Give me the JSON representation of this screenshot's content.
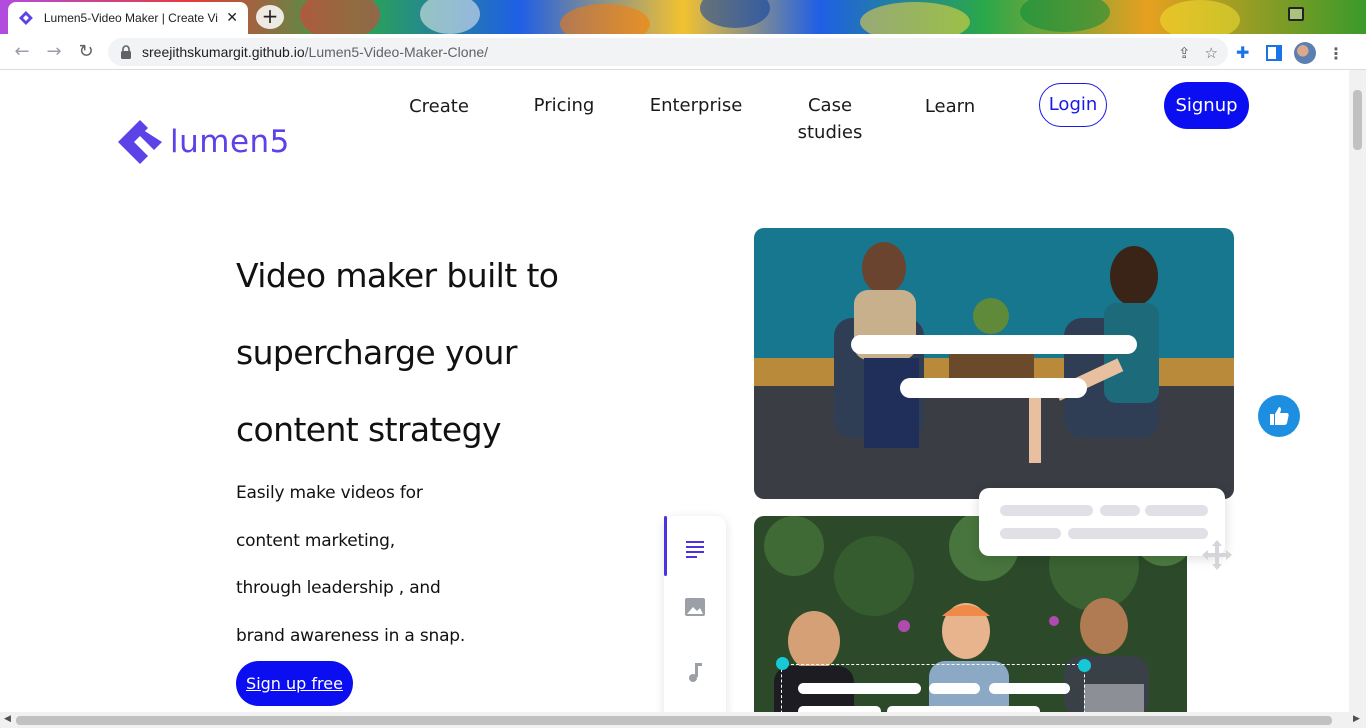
{
  "browser": {
    "tab_title": "Lumen5-Video Maker | Create Vi",
    "tab_close": "✕",
    "new_tab": "+",
    "url_host": "sreejithskumargit.github.io",
    "url_path": "/Lumen5-Video-Maker-Clone/"
  },
  "header": {
    "logo_text": "lumen5",
    "nav": [
      "Create",
      "Pricing",
      "Enterprise",
      "Case studies",
      "Learn"
    ],
    "login_label": "Login",
    "signup_label": "Signup"
  },
  "hero": {
    "headline_lines": [
      "Video maker built to",
      "supercharge your",
      "content strategy"
    ],
    "sub_lines": [
      "Easily make videos for",
      "content marketing,",
      "through leadership , and",
      "brand awareness in a snap."
    ],
    "cta_label": "Sign up free"
  },
  "colors": {
    "brand_purple": "#5c43e8",
    "cta_blue": "#0b0ef0",
    "thumbs_blue": "#1e8fe0",
    "handle_cyan": "#17c8d6"
  },
  "icons": {
    "editor_tools": [
      "text-lines-icon",
      "image-icon",
      "music-note-icon"
    ],
    "floating": "thumbs-up-icon",
    "move": "move-arrows-icon"
  }
}
